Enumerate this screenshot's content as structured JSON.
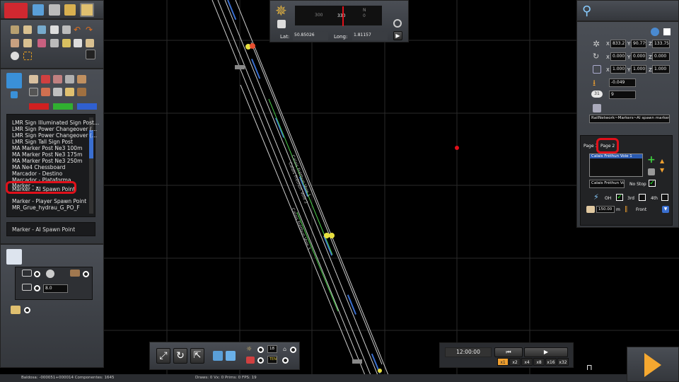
{
  "compass": {
    "lat_label": "Lat:",
    "lat_value": "50.85026",
    "long_label": "Long:",
    "long_value": "1.81157",
    "heading": "330",
    "scale_left": "300",
    "scale_right": "0",
    "north": "N"
  },
  "object_list": {
    "items": [
      "LMR Sign Illuminated Sign Post...",
      "LMR Sign Power Changeover (...",
      "LMR Sign Power Changeover (...",
      "LMR Sign Tall Sign Post",
      "MA Marker Post Ne3 100m",
      "MA Marker Post Ne3 175m",
      "MA Marker Post Ne3 250m",
      "MA Ne4 Chessboard",
      "Marcador - Destino",
      "Marcador - Plataforma",
      "Marker - AI Spawn Point",
      "Marker - Player Spawn Point",
      "MR_Grue_hydrau_G_PO_F"
    ],
    "partial_item": "Marker - ...",
    "selected": "Marker - AI Spawn Point",
    "selected_display": "Marker - AI Spawn Point"
  },
  "tool_panel": {
    "spacing_value": "8.0"
  },
  "properties": {
    "x_label": "X",
    "y_label": "Y",
    "z_label": "Z",
    "pos_x": "833.276",
    "pos_y": "90.779",
    "pos_z": "133.751",
    "rot_x": "0.000",
    "rot_y": "0.000",
    "rot_z": "0.000",
    "scale_x": "1.000",
    "scale_y": "1.000",
    "scale_z": "1.000",
    "height": "-0.049",
    "count": "9",
    "count_badge": "31",
    "blueprint": "RailNetwork~Markers~AI spawn marker.xml"
  },
  "marker_panel": {
    "tab1": "Page 1",
    "tab2": "Page 2",
    "list_item": "Calais Fréthun Voie 1",
    "name_field": "Calais Fréthun Voie",
    "no_stop": "No Stop",
    "oh_label": "OH",
    "third_label": "3rd",
    "fourth_label": "4th",
    "length": "150.00",
    "length_unit": "m",
    "direction": "Front"
  },
  "track_labels": [
    "Calais Fréthun Voie 1",
    "Calais Fréthun Voie 2",
    "Calais Fréthun Voie 3"
  ],
  "clock": {
    "time": "12:00:00",
    "speeds": [
      "x1",
      "x2",
      "x4",
      "x8",
      "x16",
      "x32"
    ]
  },
  "bottom_tools": {
    "rain_value": "18",
    "snow_value": "TEN"
  },
  "status": {
    "tile": "Baldosa: -000051+000014  Componentes: 1645",
    "stats": "Draws: 0 Vx: 0 Prims: 0 FPS: 19"
  },
  "colors": {
    "panel": "#3e4147",
    "track_green": "#4cd14c",
    "annotation": "#e0101a",
    "accent_orange": "#f0a030"
  }
}
